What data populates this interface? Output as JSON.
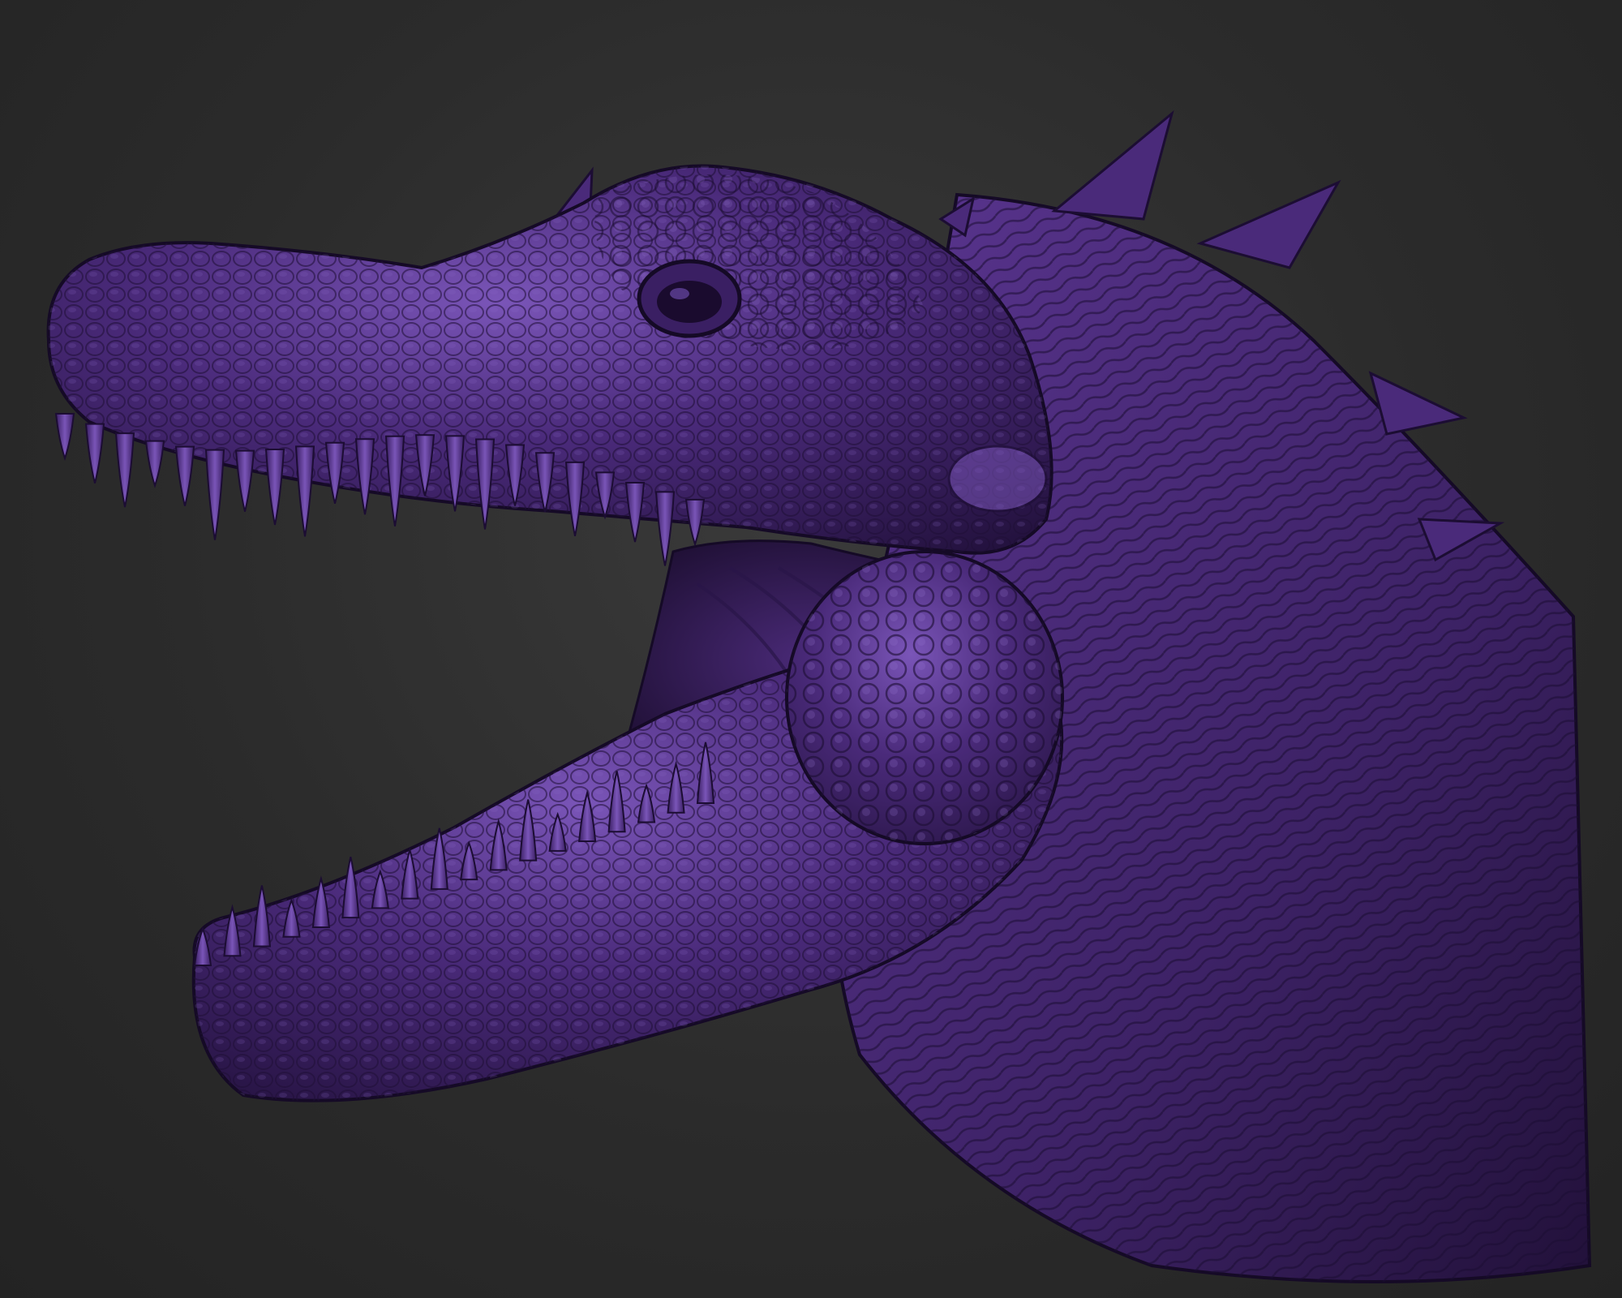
{
  "scene": {
    "subject": "sculpted-dinosaur-head",
    "colors": {
      "background": "#2a2a2a",
      "skin_base": "#4a2a7a",
      "skin_light": "#7a55b8",
      "skin_dark": "#24123f",
      "teeth": "#6a45a8"
    }
  }
}
